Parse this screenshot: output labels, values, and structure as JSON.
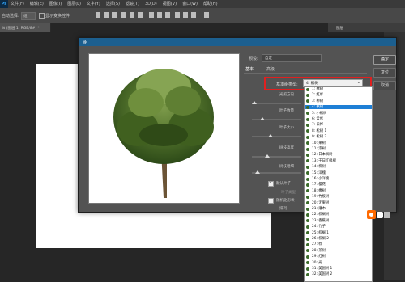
{
  "menubar": {
    "items": [
      "文件(F)",
      "编辑(E)",
      "图像(I)",
      "图层(L)",
      "文字(Y)",
      "选择(S)",
      "滤镜(T)",
      "3D(D)",
      "视图(V)",
      "窗口(W)",
      "帮助(H)"
    ]
  },
  "options": {
    "auto_select": "自动选择:",
    "group": "组",
    "show_transform": "显示变换控件"
  },
  "document_tab": "% (图层 1, RGB/8#) *",
  "panel_title": "图层",
  "dialog": {
    "title": "树",
    "preset_label": "预设:",
    "preset_value": "自定",
    "tabs": [
      "基本",
      "高级"
    ],
    "tree_type_label": "基本树类型:",
    "tree_type_value": "4: 枫树",
    "params": [
      "光照方向",
      "叶子数量",
      "叶子大小",
      "树枝高度",
      "树枝粗细"
    ],
    "default_leaves": "默认叶子",
    "leaf_type": "叶子类型",
    "random_shape": "随机化形状",
    "arrangement": "排列",
    "buttons": {
      "ok": "确定",
      "reset": "复位",
      "cancel": "取消"
    }
  },
  "tree_types": [
    "1: 橡树",
    "2: 红杉",
    "3: 柳树",
    "4: 枫树",
    "5: 小枫树",
    "6: 云杉",
    "7: 白桦",
    "8: 松树 1",
    "9: 松树 2",
    "10: 果树",
    "11: 漆树",
    "12: 日本枫树",
    "13: 千日红枫树",
    "14: 柳树",
    "15: 洋槐",
    "16: 小洋槐",
    "17: 樱花",
    "18: 橡树",
    "19: 竹板树",
    "20: 无果树",
    "21: 灌木",
    "22: 棕榈树",
    "23: 香蕉树",
    "24: 竹子",
    "25: 棕榈 1",
    "26: 棕榈 2",
    "27: 栎",
    "28: 茶树",
    "29: 红树",
    "30: 光",
    "31: 美国树 1",
    "32: 美国树 2"
  ],
  "selected_index": 3,
  "colors": {
    "accent": "#1e7fd6",
    "highlight": "#e02020",
    "titlebar": "#1c5f8f"
  }
}
